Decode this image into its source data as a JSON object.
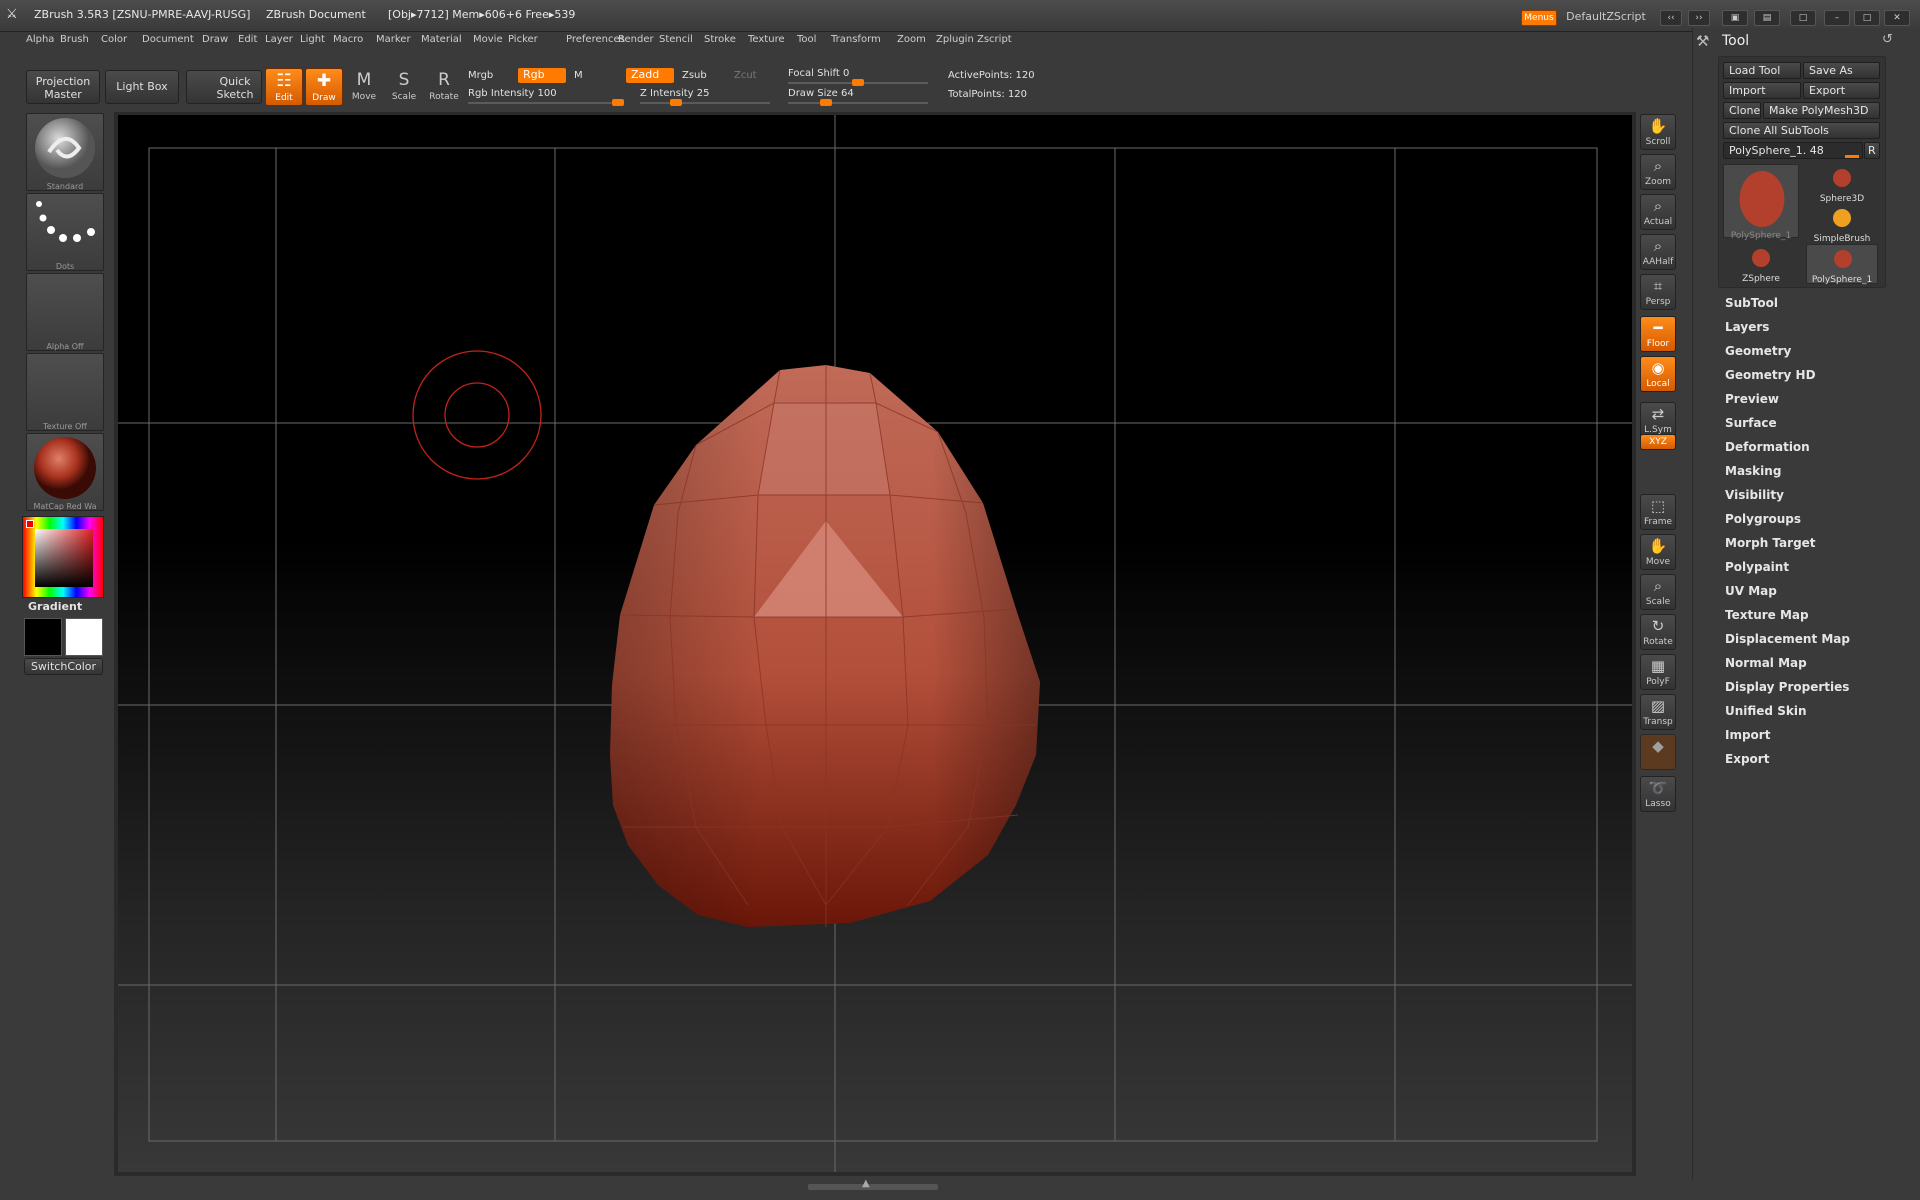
{
  "titlebar": {
    "app": "ZBrush 3.5R3 [ZSNU-PMRE-AAVJ-RUSG]",
    "document": "ZBrush Document",
    "status": "[Obj▸7712] Mem▸606+6 Free▸539",
    "menus_btn": "Menus",
    "script": "DefaultZScript"
  },
  "menubar": [
    "Alpha",
    "Brush",
    "Color",
    "Document",
    "Draw",
    "Edit",
    "Layer",
    "Light",
    "Macro",
    "Marker",
    "Material",
    "Movie",
    "Picker",
    "Preferences",
    "Render",
    "Stencil",
    "Stroke",
    "Texture",
    "Tool",
    "Transform",
    "Zoom",
    "Zplugin",
    "Zscript"
  ],
  "shelf": {
    "projection_master": "Projection Master",
    "light_box": "Light Box",
    "quick_sketch": "Quick Sketch",
    "modes": [
      {
        "label": "Edit",
        "icon": "edit-icon",
        "on": true
      },
      {
        "label": "Draw",
        "icon": "draw-icon",
        "on": true
      },
      {
        "label": "Move",
        "icon": "move-icon",
        "on": false
      },
      {
        "label": "Scale",
        "icon": "scale-icon",
        "on": false
      },
      {
        "label": "Rotate",
        "icon": "rotate-icon",
        "on": false
      }
    ],
    "mrgb": "Mrgb",
    "rgb": "Rgb",
    "m": "M",
    "zadd": "Zadd",
    "zsub": "Zsub",
    "zcut": "Zcut",
    "rgb_intensity": "Rgb Intensity 100",
    "rgb_intensity_value": 100,
    "z_intensity": "Z Intensity 25",
    "z_intensity_value": 25,
    "focal_shift": "Focal Shift 0",
    "focal_shift_value": 0,
    "draw_size": "Draw Size 64",
    "draw_size_value": 64,
    "active_points": "ActivePoints: 120",
    "total_points": "TotalPoints: 120"
  },
  "left": {
    "brush": "Standard",
    "stroke": "Dots",
    "alpha": "Alpha Off",
    "texture": "Texture Off",
    "material": "MatCap Red Wa",
    "gradient": "Gradient",
    "switchcolor": "SwitchColor"
  },
  "right_shelf": [
    {
      "label": "Scroll",
      "icon": "hand-icon",
      "on": false
    },
    {
      "label": "Zoom",
      "icon": "zoom-icon",
      "on": false
    },
    {
      "label": "Actual",
      "icon": "actual-icon",
      "on": false
    },
    {
      "label": "AAHalf",
      "icon": "aahalf-icon",
      "on": false
    },
    {
      "label": "Persp",
      "icon": "persp-icon",
      "on": false
    },
    {
      "label": "Floor",
      "icon": "floor-icon",
      "on": true
    },
    {
      "label": "Local",
      "icon": "local-icon",
      "on": true
    },
    {
      "label": "L.Sym",
      "icon": "lsym-icon",
      "on": false
    },
    {
      "label": "XYZ",
      "icon": "xyz-icon",
      "on": true
    },
    {
      "label": "Frame",
      "icon": "frame-icon",
      "on": false
    },
    {
      "label": "Move",
      "icon": "move-icon",
      "on": false
    },
    {
      "label": "Scale",
      "icon": "scale-icon",
      "on": false
    },
    {
      "label": "Rotate",
      "icon": "rotate-icon",
      "on": false
    },
    {
      "label": "PolyF",
      "icon": "polyf-icon",
      "on": false
    },
    {
      "label": "Transp",
      "icon": "transp-icon",
      "on": false
    },
    {
      "label": "",
      "icon": "ghost-icon",
      "on": false
    },
    {
      "label": "Lasso",
      "icon": "lasso-icon",
      "on": false
    }
  ],
  "tool_panel": {
    "title": "Tool",
    "load_tool": "Load Tool",
    "save_as": "Save As",
    "import": "Import",
    "export": "Export",
    "clone": "Clone",
    "make_polymesh": "Make PolyMesh3D",
    "clone_all": "Clone All SubTools",
    "current_tool": "PolySphere_1. 48",
    "r_btn": "R",
    "tools": [
      {
        "label": "PolySphere_1",
        "kind": "large"
      },
      {
        "label": "Sphere3D",
        "kind": "small"
      },
      {
        "label": "SimpleBrush",
        "kind": "small"
      },
      {
        "label": "ZSphere",
        "kind": "small"
      },
      {
        "label": "PolySphere_1",
        "kind": "small"
      }
    ],
    "sections": [
      "SubTool",
      "Layers",
      "Geometry",
      "Geometry HD",
      "Preview",
      "Surface",
      "Deformation",
      "Masking",
      "Visibility",
      "Polygroups",
      "Morph Target",
      "Polypaint",
      "UV Map",
      "Texture Map",
      "Displacement Map",
      "Normal Map",
      "Display Properties",
      "Unified Skin",
      "Import",
      "Export"
    ]
  },
  "colors": {
    "accent": "#ff7a00",
    "mesh": "#b8503c",
    "cursor": "#c0241a"
  }
}
